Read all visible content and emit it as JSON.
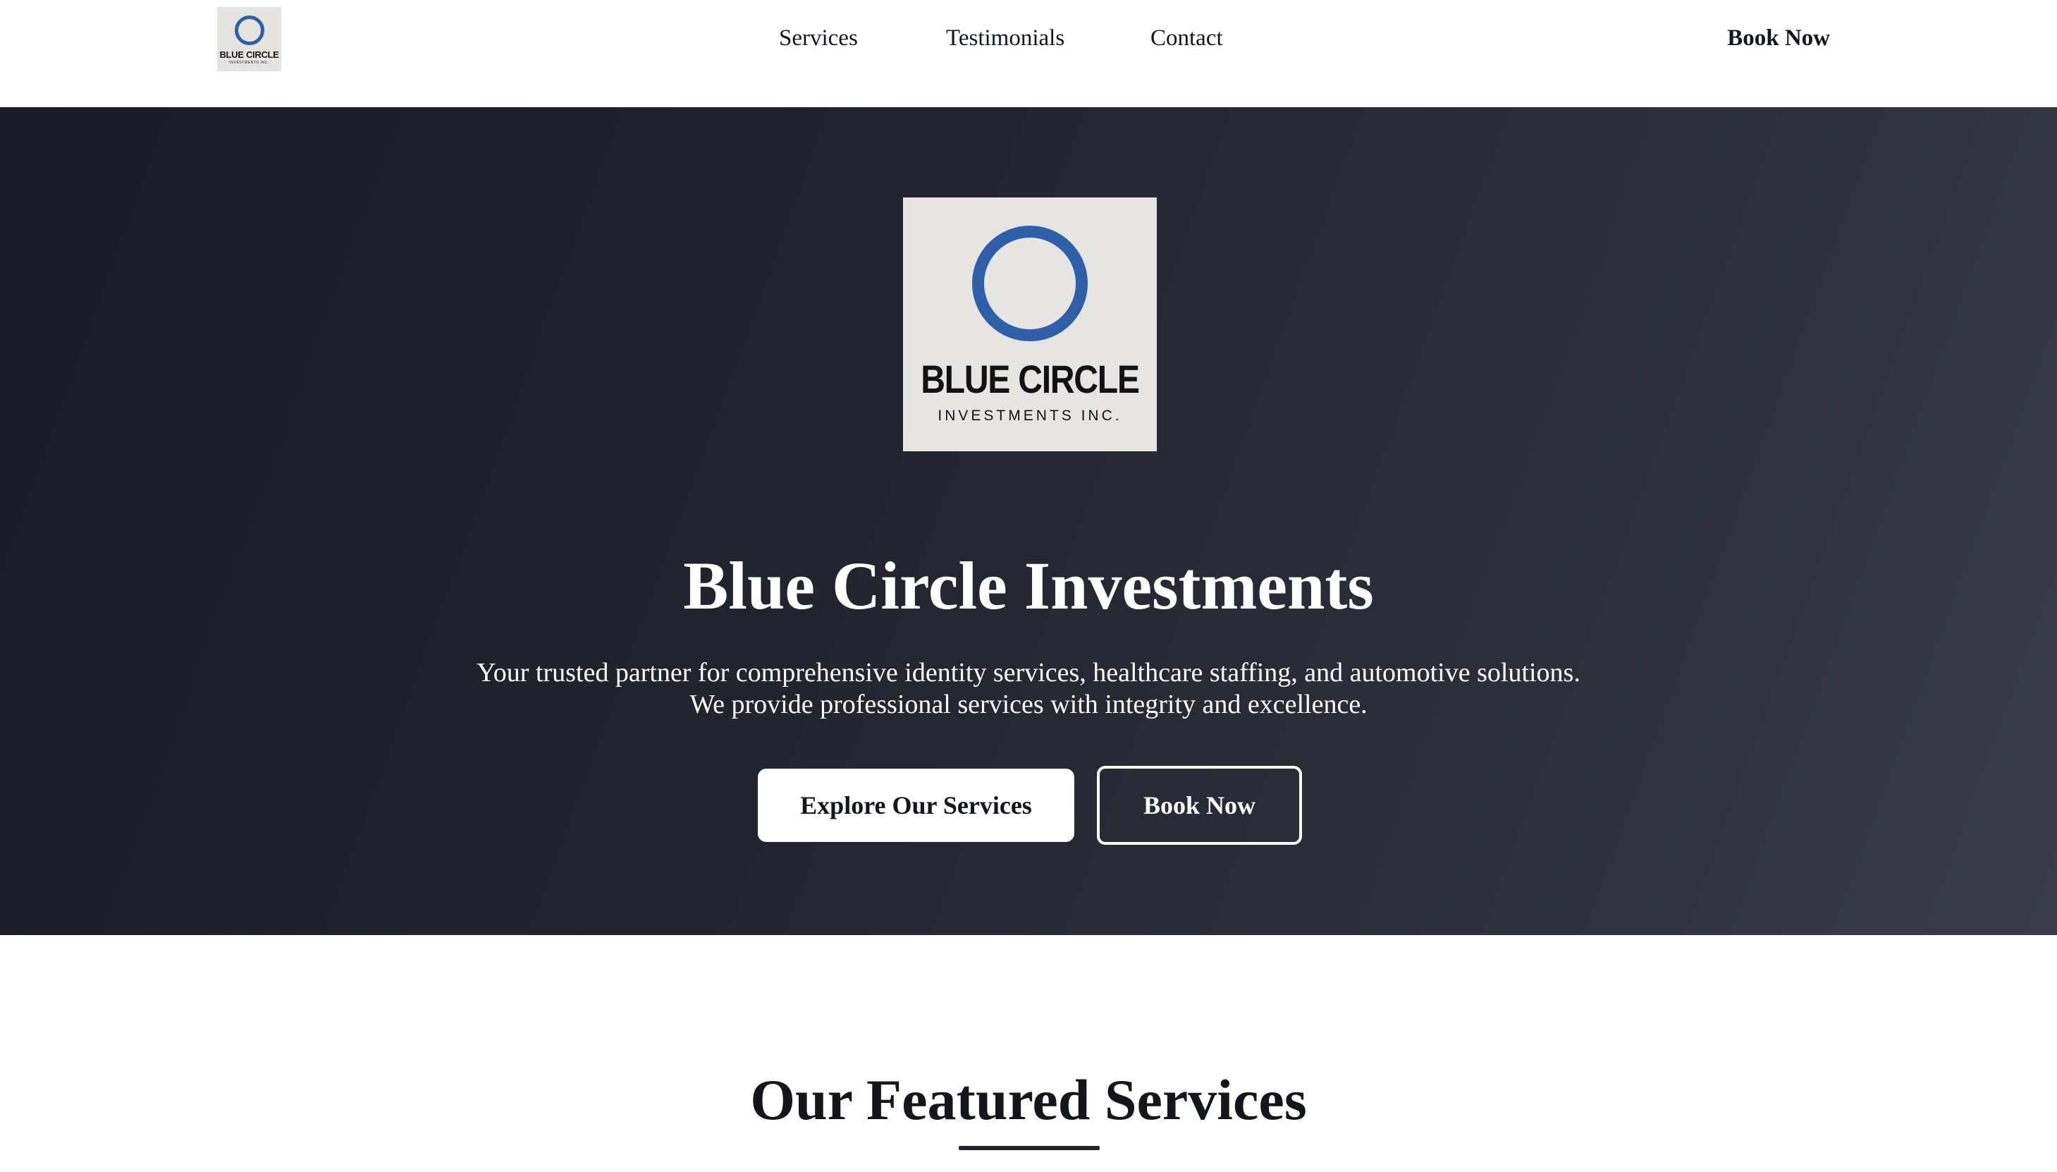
{
  "header": {
    "logo": {
      "brand": "BLUE CIRCLE",
      "sub": "INVESTMENTS INC."
    },
    "nav": [
      {
        "label": "Services"
      },
      {
        "label": "Testimonials"
      },
      {
        "label": "Contact"
      }
    ],
    "book_label": "Book Now"
  },
  "hero": {
    "logo": {
      "brand": "BLUE CIRCLE",
      "sub": "INVESTMENTS INC."
    },
    "title": "Blue Circle Investments",
    "subtitle_line1": "Your trusted partner for comprehensive identity services, healthcare staffing, and automotive solutions.",
    "subtitle_line2": "We provide professional services with integrity and excellence.",
    "primary_button": "Explore Our Services",
    "secondary_button": "Book Now"
  },
  "featured": {
    "title": "Our Featured Services"
  },
  "colors": {
    "brand_blue": "#2e5fa8",
    "hero_dark": "#1a1b24",
    "text_dark": "#15161c"
  }
}
